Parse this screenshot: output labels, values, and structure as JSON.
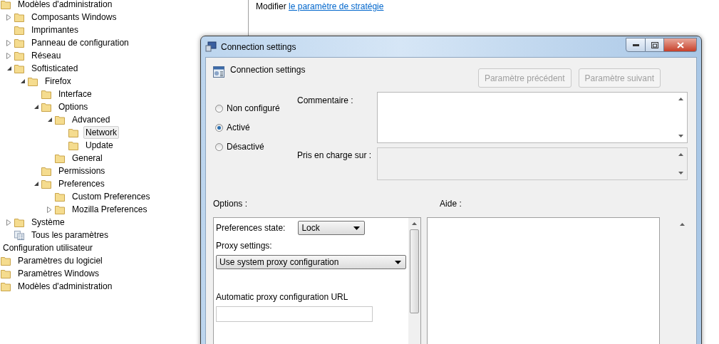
{
  "tree": [
    {
      "label": "Modèles d'administration",
      "kind": "folder",
      "selected": false,
      "children": [
        {
          "label": "Composants Windows",
          "kind": "folder",
          "expanded": false,
          "selected": false
        },
        {
          "label": "Imprimantes",
          "kind": "folder",
          "selected": false
        },
        {
          "label": "Panneau de configuration",
          "kind": "folder",
          "expanded": false,
          "selected": false
        },
        {
          "label": "Réseau",
          "kind": "folder",
          "expanded": false,
          "selected": false
        },
        {
          "label": "Softisticated",
          "kind": "folder",
          "expanded": true,
          "selected": false,
          "children": [
            {
              "label": "Firefox",
              "kind": "folder",
              "expanded": true,
              "selected": false,
              "children": [
                {
                  "label": "Interface",
                  "kind": "folder",
                  "selected": false
                },
                {
                  "label": "Options",
                  "kind": "folder",
                  "expanded": true,
                  "selected": false,
                  "children": [
                    {
                      "label": "Advanced",
                      "kind": "folder",
                      "expanded": true,
                      "selected": false,
                      "children": [
                        {
                          "label": "Network",
                          "kind": "folder",
                          "selected": true
                        },
                        {
                          "label": "Update",
                          "kind": "folder",
                          "selected": false
                        }
                      ]
                    },
                    {
                      "label": "General",
                      "kind": "folder",
                      "selected": false
                    }
                  ]
                },
                {
                  "label": "Permissions",
                  "kind": "folder",
                  "selected": false
                },
                {
                  "label": "Preferences",
                  "kind": "folder",
                  "expanded": true,
                  "selected": false,
                  "children": [
                    {
                      "label": "Custom Preferences",
                      "kind": "folder",
                      "selected": false
                    },
                    {
                      "label": "Mozilla Preferences",
                      "kind": "folder",
                      "expanded": false,
                      "selected": false
                    }
                  ]
                }
              ]
            }
          ]
        },
        {
          "label": "Système",
          "kind": "folder",
          "expanded": false,
          "selected": false
        },
        {
          "label": "Tous les paramètres",
          "kind": "settings",
          "selected": false
        }
      ]
    },
    {
      "label": "Configuration utilisateur",
      "kind": "text",
      "selected": false
    },
    {
      "label": "Paramètres du logiciel",
      "kind": "folder",
      "selected": false
    },
    {
      "label": "Paramètres Windows",
      "kind": "folder",
      "selected": false
    },
    {
      "label": "Modèles d'administration",
      "kind": "folder",
      "selected": false
    }
  ],
  "details": {
    "prefix": "Modifier",
    "link": "le paramètre de stratégie"
  },
  "dialog": {
    "title": "Connection settings",
    "heading": "Connection settings",
    "buttons": [
      {
        "label": "Paramètre précédent",
        "disabled": true
      },
      {
        "label": "Paramètre suivant",
        "disabled": true
      }
    ],
    "states": [
      {
        "label": "Non configuré",
        "selected": false
      },
      {
        "label": "Activé",
        "selected": true
      },
      {
        "label": "Désactivé",
        "selected": false
      }
    ],
    "comment_label": "Commentaire :",
    "supported_label": "Pris en charge sur :",
    "options_label": "Options :",
    "help_label": "Aide :",
    "options": [
      {
        "kind": "inline-select",
        "label": "Preferences state:",
        "value": "Lock"
      },
      {
        "kind": "heading",
        "label": "Proxy settings:"
      },
      {
        "kind": "select",
        "value": "Use system proxy configuration"
      },
      {
        "kind": "input",
        "label": "Automatic proxy configuration URL"
      }
    ]
  }
}
